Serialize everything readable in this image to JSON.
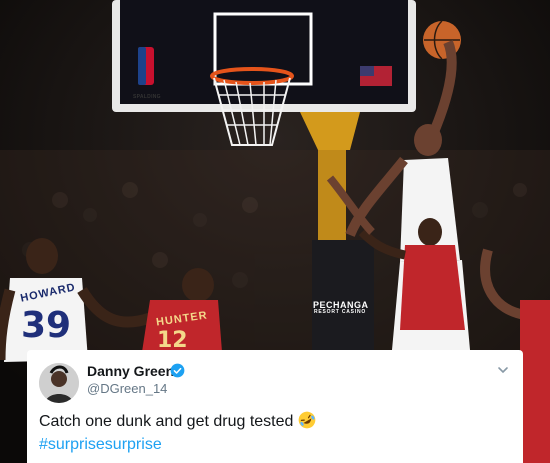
{
  "photo": {
    "jersey_left_name": "HOWARD",
    "jersey_left_number": "39",
    "jersey_right_name": "HUNTER",
    "jersey_right_number": "12",
    "sponsor_line1": "PECHANGA",
    "sponsor_line2": "RESORT CASINO",
    "backboard_brand": "SPALDING"
  },
  "tweet": {
    "display_name": "Danny Green",
    "handle": "@DGreen_14",
    "text": "Catch one dunk and get drug tested",
    "hashtag": "#surprisesurprise",
    "verified": true,
    "emoji": "rolling-on-floor-laughing"
  },
  "colors": {
    "hashtag": "#1da1f2",
    "verified": "#1da1f2",
    "name": "#14171a",
    "handle": "#657786"
  }
}
